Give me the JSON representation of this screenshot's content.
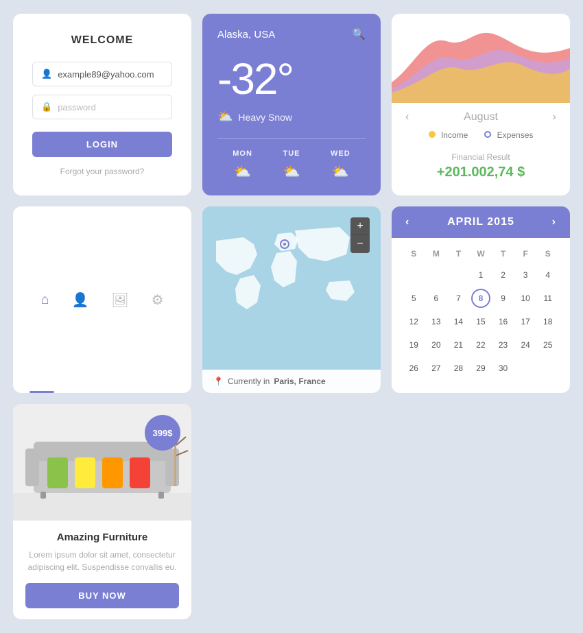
{
  "login": {
    "title": "WELCOME",
    "email_placeholder": "example89@yahoo.com",
    "email_value": "example89@yahoo.com",
    "password_placeholder": "password",
    "login_label": "LOGIN",
    "forgot_label": "Forgot your password?"
  },
  "weather": {
    "location": "Alaska, USA",
    "temperature": "-32°",
    "description": "Heavy Snow",
    "forecast": [
      {
        "day": "MON"
      },
      {
        "day": "TUE"
      },
      {
        "day": "WED"
      }
    ]
  },
  "finance": {
    "prev_label": "‹",
    "next_label": "›",
    "month": "August",
    "income_label": "Income",
    "expenses_label": "Expenses",
    "result_label": "Financial Result",
    "amount": "+201.002,74 $",
    "income_color": "#f5c842",
    "expenses_color": "#7b7fd4"
  },
  "nav": {
    "icons": [
      "home",
      "person",
      "image",
      "settings"
    ]
  },
  "map": {
    "location_label": "Currently in",
    "city": "Paris, France"
  },
  "calendar": {
    "prev_label": "‹",
    "next_label": "›",
    "month": "APRIL 2015",
    "day_headers": [
      "S",
      "M",
      "T",
      "W",
      "T",
      "F",
      "S"
    ],
    "weeks": [
      [
        "",
        "",
        "",
        "1",
        "2",
        "3",
        "4"
      ],
      [
        "5",
        "6",
        "7",
        "8",
        "9",
        "10",
        "11"
      ],
      [
        "12",
        "13",
        "14",
        "15",
        "16",
        "17",
        "18"
      ],
      [
        "19",
        "20",
        "21",
        "22",
        "23",
        "24",
        "25"
      ],
      [
        "26",
        "27",
        "28",
        "29",
        "30",
        "",
        ""
      ]
    ],
    "selected_day": "8"
  },
  "furniture": {
    "price": "399$",
    "title": "Amazing Furniture",
    "description": "Lorem ipsum dolor sit amet, consectetur adipiscing elit. Suspendisse convallis eu.",
    "buy_label": "BUY NOW"
  }
}
